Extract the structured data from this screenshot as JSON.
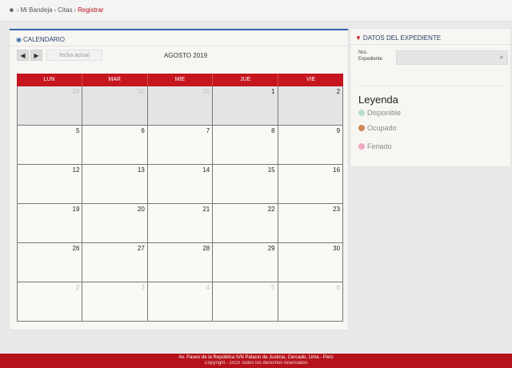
{
  "breadcrumb": {
    "items": [
      "Mi Bandeja",
      "Citas",
      "Registrar"
    ]
  },
  "calendar": {
    "title": "CALENDARIO",
    "today_label": "fecha actual",
    "month_label": "AGOSTO 2019",
    "weekdays": [
      "LUN",
      "MAR",
      "MIE",
      "JUE",
      "VIE"
    ],
    "weeks": [
      [
        "29",
        "30",
        "31",
        "1",
        "2"
      ],
      [
        "5",
        "6",
        "7",
        "8",
        "9"
      ],
      [
        "12",
        "13",
        "14",
        "15",
        "16"
      ],
      [
        "19",
        "20",
        "21",
        "22",
        "23"
      ],
      [
        "26",
        "27",
        "28",
        "29",
        "30"
      ],
      [
        "2",
        "3",
        "4",
        "5",
        "6"
      ]
    ]
  },
  "expediente": {
    "title": "DATOS DEL EXPEDIENTE",
    "field_label_1": "Nro.",
    "field_label_2": "Expediente",
    "field_value": ""
  },
  "legend": {
    "title": "Leyenda",
    "items": [
      {
        "label": "Disponible",
        "color": "#b9dcc8"
      },
      {
        "label": "Ocupado",
        "color": "#d08a57"
      },
      {
        "label": "Feriado",
        "color": "#eea8c0"
      }
    ]
  },
  "footer": {
    "line1": "Av. Paseo de la República S/N Palacio de Justicia, Cercado, Lima - Perú",
    "line2": "Copyright - 2019 Todos los derechos reservados"
  },
  "colors": {
    "accent_red": "#c5161f",
    "accent_blue": "#2f67a7"
  }
}
